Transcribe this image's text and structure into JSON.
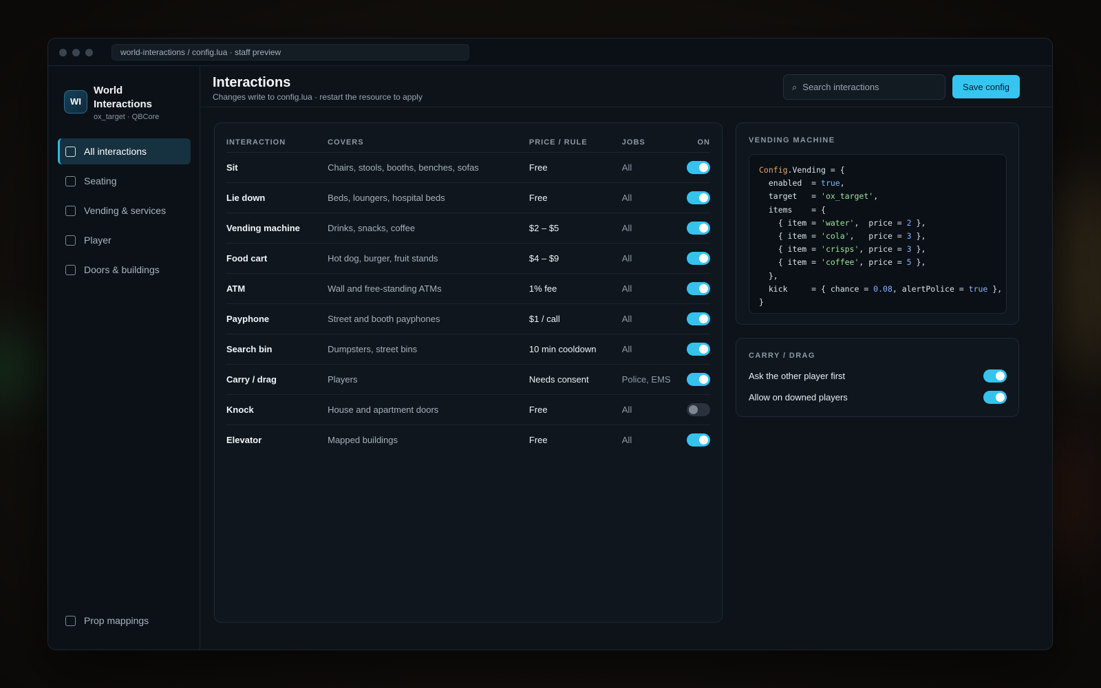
{
  "window": {
    "address": "world-interactions / config.lua · staff preview"
  },
  "brand": {
    "logo": "WI",
    "name": "World Interactions",
    "sub": "ox_target · QBCore"
  },
  "nav": {
    "items": [
      {
        "label": "All interactions",
        "active": true
      },
      {
        "label": "Seating"
      },
      {
        "label": "Vending & services"
      },
      {
        "label": "Player"
      },
      {
        "label": "Doors & buildings"
      }
    ],
    "bottom": {
      "label": "Prop mappings"
    }
  },
  "header": {
    "title": "Interactions",
    "subtitle": "Changes write to config.lua · restart the resource to apply",
    "search_placeholder": "Search interactions",
    "search_icon": "⌕",
    "save_label": "Save config"
  },
  "table": {
    "columns": [
      "INTERACTION",
      "COVERS",
      "PRICE / RULE",
      "JOBS",
      "ON"
    ],
    "rows": [
      {
        "name": "Sit",
        "covers": "Chairs, stools, booths, benches, sofas",
        "price": "Free",
        "jobs": "All",
        "on": true
      },
      {
        "name": "Lie down",
        "covers": "Beds, loungers, hospital beds",
        "price": "Free",
        "jobs": "All",
        "on": true
      },
      {
        "name": "Vending machine",
        "covers": "Drinks, snacks, coffee",
        "price": "$2 – $5",
        "jobs": "All",
        "on": true
      },
      {
        "name": "Food cart",
        "covers": "Hot dog, burger, fruit stands",
        "price": "$4 – $9",
        "jobs": "All",
        "on": true
      },
      {
        "name": "ATM",
        "covers": "Wall and free-standing ATMs",
        "price": "1% fee",
        "jobs": "All",
        "on": true
      },
      {
        "name": "Payphone",
        "covers": "Street and booth payphones",
        "price": "$1 / call",
        "jobs": "All",
        "on": true
      },
      {
        "name": "Search bin",
        "covers": "Dumpsters, street bins",
        "price": "10 min cooldown",
        "jobs": "All",
        "on": true
      },
      {
        "name": "Carry / drag",
        "covers": "Players",
        "price": "Needs consent",
        "jobs": "Police, EMS",
        "on": true
      },
      {
        "name": "Knock",
        "covers": "House and apartment doors",
        "price": "Free",
        "jobs": "All",
        "on": false
      },
      {
        "name": "Elevator",
        "covers": "Mapped buildings",
        "price": "Free",
        "jobs": "All",
        "on": true
      }
    ]
  },
  "vending_card": {
    "title": "VENDING MACHINE",
    "code": [
      [
        [
          "k",
          "Config"
        ],
        [
          "t",
          ".Vending = {"
        ]
      ],
      [
        [
          "t",
          "  enabled  = "
        ],
        [
          "n",
          "true"
        ],
        [
          "t",
          ","
        ]
      ],
      [
        [
          "t",
          "  target   = "
        ],
        [
          "s",
          "'ox_target'"
        ],
        [
          "t",
          ","
        ]
      ],
      [
        [
          "t",
          "  items    = {"
        ]
      ],
      [
        [
          "t",
          "    { item = "
        ],
        [
          "s",
          "'water'"
        ],
        [
          "t",
          ",  price = "
        ],
        [
          "n",
          "2"
        ],
        [
          "t",
          " },"
        ]
      ],
      [
        [
          "t",
          "    { item = "
        ],
        [
          "s",
          "'cola'"
        ],
        [
          "t",
          ",   price = "
        ],
        [
          "n",
          "3"
        ],
        [
          "t",
          " },"
        ]
      ],
      [
        [
          "t",
          "    { item = "
        ],
        [
          "s",
          "'crisps'"
        ],
        [
          "t",
          ", price = "
        ],
        [
          "n",
          "3"
        ],
        [
          "t",
          " },"
        ]
      ],
      [
        [
          "t",
          "    { item = "
        ],
        [
          "s",
          "'coffee'"
        ],
        [
          "t",
          ", price = "
        ],
        [
          "n",
          "5"
        ],
        [
          "t",
          " },"
        ]
      ],
      [
        [
          "t",
          "  },"
        ]
      ],
      [
        [
          "t",
          "  kick     = { chance = "
        ],
        [
          "n",
          "0.08"
        ],
        [
          "t",
          ", alertPolice = "
        ],
        [
          "n",
          "true"
        ],
        [
          "t",
          " },"
        ]
      ],
      [
        [
          "t",
          "}"
        ]
      ]
    ]
  },
  "carry_card": {
    "title": "CARRY / DRAG",
    "options": [
      {
        "label": "Ask the other player first",
        "on": true
      },
      {
        "label": "Allow on downed players",
        "on": true
      }
    ]
  },
  "colors": {
    "accent": "#36c5f0",
    "background": "#0d1319",
    "toggle_off": "#2a333d"
  }
}
